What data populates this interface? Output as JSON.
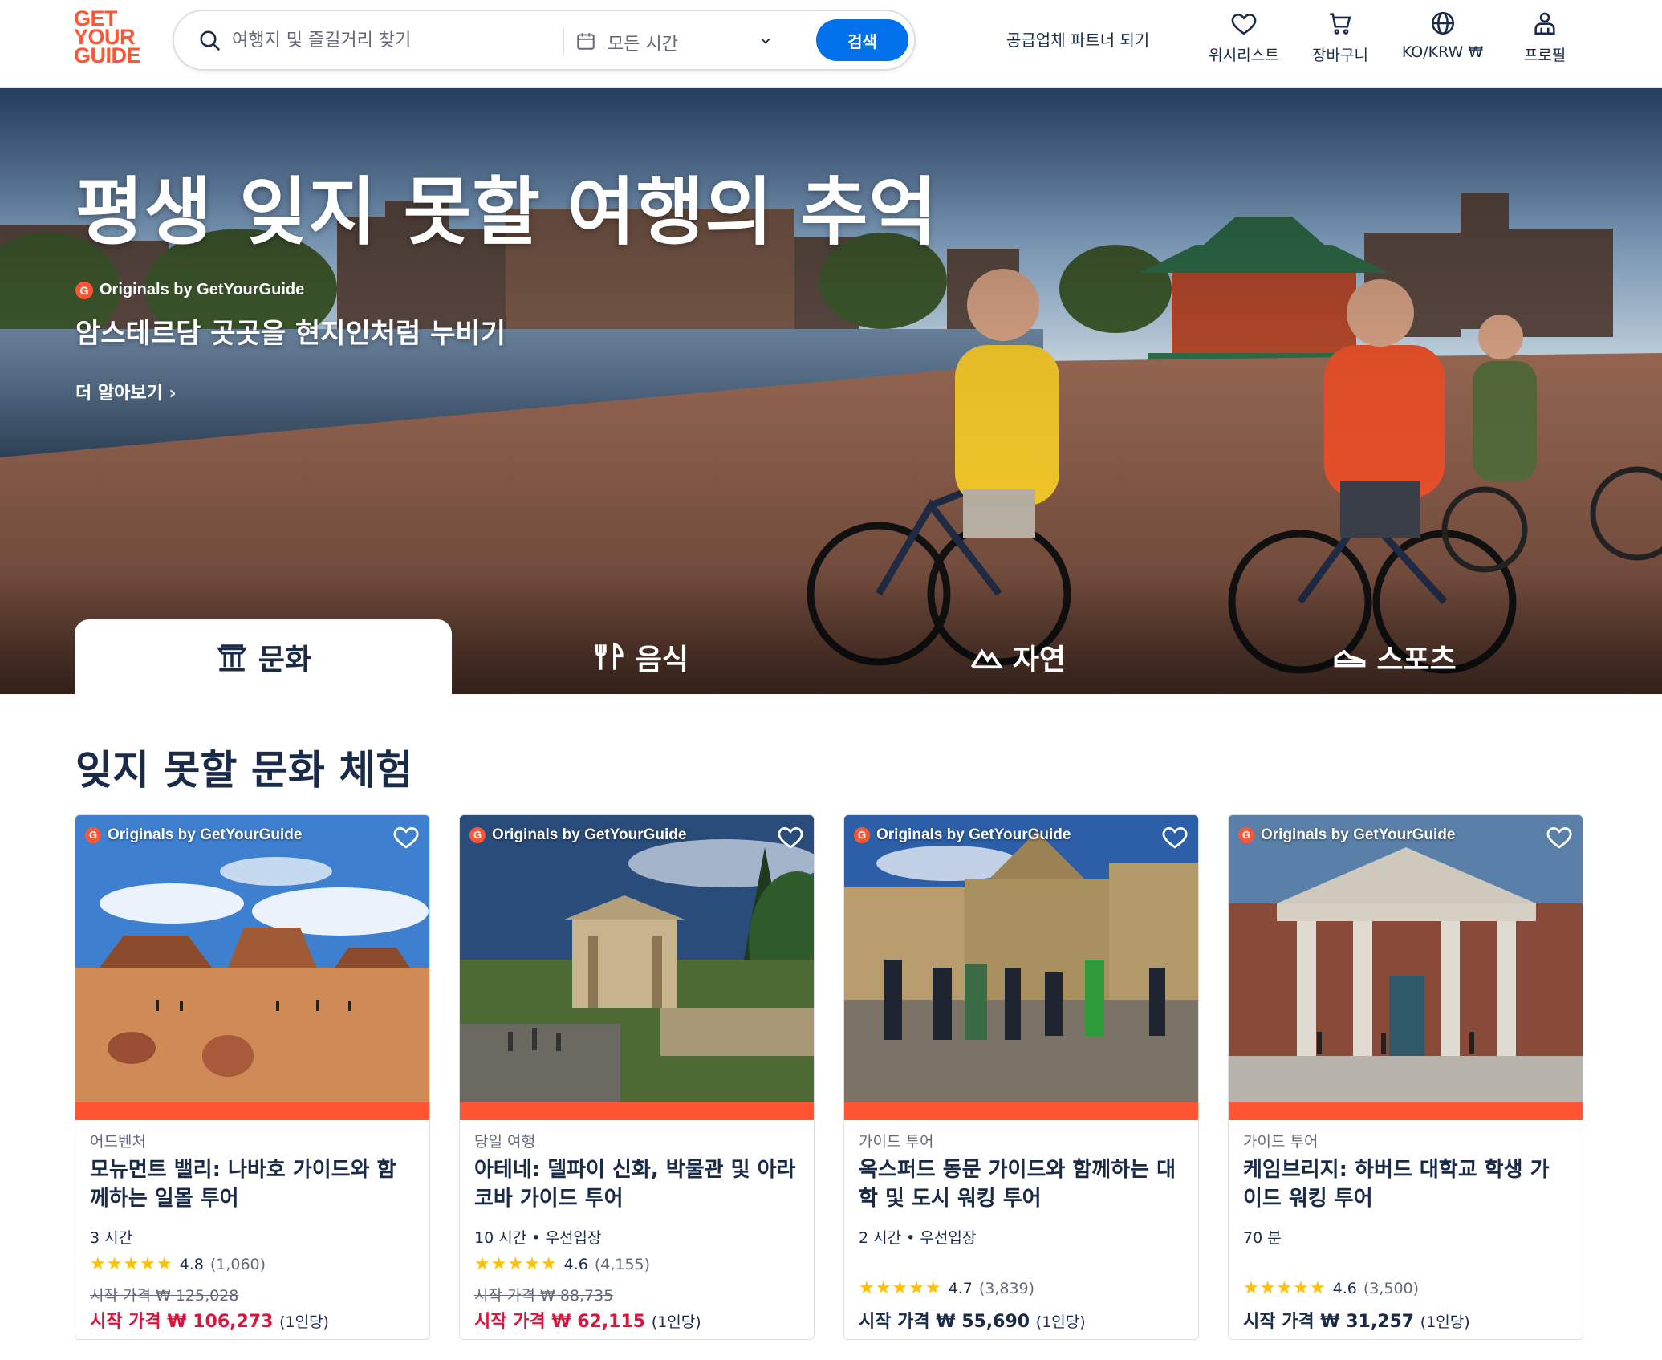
{
  "header": {
    "logo": [
      "GET",
      "YOUR",
      "GUIDE"
    ],
    "search": {
      "placeholder": "여행지 및 즐길거리 찾기",
      "value": ""
    },
    "date_label": "모든 시간",
    "search_button": "검색",
    "partner_link": "공급업체 파트너 되기",
    "nav": {
      "wishlist": "위시리스트",
      "cart": "장바구니",
      "locale": "KO/KRW ₩",
      "profile": "프로필"
    }
  },
  "hero": {
    "title": "평생 잊지 못할 여행의 추억",
    "originals": "Originals by GetYourGuide",
    "subtitle": "암스테르담 곳곳을 현지인처럼 누비기",
    "more": "더 알아보기 ›",
    "tabs": [
      {
        "label": "문화",
        "icon": "museum-icon",
        "active": true
      },
      {
        "label": "음식",
        "icon": "fork-knife-icon",
        "active": false
      },
      {
        "label": "자연",
        "icon": "mountain-icon",
        "active": false
      },
      {
        "label": "스포츠",
        "icon": "sneaker-icon",
        "active": false
      }
    ]
  },
  "section": {
    "title": "잊지 못할 문화 체험",
    "cards": [
      {
        "badge": "Originals by GetYourGuide",
        "category": "어드벤처",
        "title": "모뉴먼트 밸리: 나바호 가이드와 함께하는 일몰 투어",
        "meta": "3 시간",
        "stars": "★★★★★",
        "rating": "4.8",
        "reviews": "(1,060)",
        "old_price": "시작 가격 ₩ 125,028",
        "price": "시작 가격 ₩ 106,273",
        "per_person": "(1인당)",
        "on_sale": true
      },
      {
        "badge": "Originals by GetYourGuide",
        "category": "당일 여행",
        "title": "아테네: 델파이 신화, 박물관 및 아라코바 가이드 투어",
        "meta": "10 시간 • 우선입장",
        "stars": "★★★★★",
        "rating": "4.6",
        "reviews": "(4,155)",
        "old_price": "시작 가격 ₩ 88,735",
        "price": "시작 가격 ₩ 62,115",
        "per_person": "(1인당)",
        "on_sale": true
      },
      {
        "badge": "Originals by GetYourGuide",
        "category": "가이드 투어",
        "title": "옥스퍼드 동문 가이드와 함께하는 대학 및 도시 워킹 투어",
        "meta": "2 시간 • 우선입장",
        "stars": "★★★★★",
        "rating": "4.7",
        "reviews": "(3,839)",
        "old_price": "",
        "price": "시작 가격 ₩ 55,690",
        "per_person": "(1인당)",
        "on_sale": false
      },
      {
        "badge": "Originals by GetYourGuide",
        "category": "가이드 투어",
        "title": "케임브리지: 하버드 대학교 학생 가이드 워킹 투어",
        "meta": "70 분",
        "stars": "★★★★★",
        "rating": "4.6",
        "reviews": "(3,500)",
        "old_price": "",
        "price": "시작 가격 ₩ 31,257",
        "per_person": "(1인당)",
        "on_sale": false
      }
    ]
  },
  "colors": {
    "brand": "#ff5533",
    "primary_button": "#0071eb",
    "text": "#1a2b49",
    "sale_price": "#dc143c",
    "star": "#ffc107"
  }
}
